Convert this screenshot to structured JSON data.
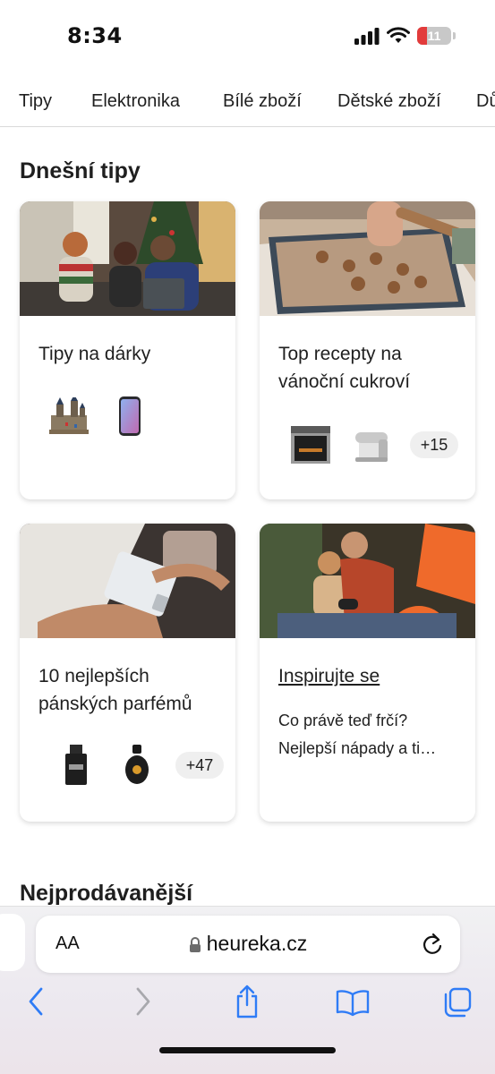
{
  "status_bar": {
    "time": "8:34",
    "battery_level": "11"
  },
  "category_tabs": [
    "Tipy",
    "Elektronika",
    "Bílé zboží",
    "Dětské zboží",
    "Dů"
  ],
  "section_title": "Dnešní tipy",
  "cards": [
    {
      "title": "Tipy na dárky",
      "photo": "family-christmas-tablet"
    },
    {
      "title": "Top recepty na vánoční cukroví",
      "photo": "gingerbread-baking",
      "more": "+15"
    },
    {
      "title": "10 nejlepších pánských parfémů",
      "photo": "perfume-bottle-hands",
      "more": "+47"
    },
    {
      "title": "Inspirujte se",
      "description": "Co právě teď frčí? Nejlepší nápady a ti…",
      "photo": "man-child-playing-games"
    }
  ],
  "next_section_title": "Nejprodávanější",
  "browser": {
    "text_size_label": "AA",
    "domain": "heureka.cz",
    "toolbar": [
      "back-icon",
      "forward-icon",
      "share-icon",
      "bookmarks-icon",
      "tabs-icon"
    ]
  },
  "colors": {
    "accent_blue": "#2f7cf6",
    "orange": "#ef6a2b"
  }
}
